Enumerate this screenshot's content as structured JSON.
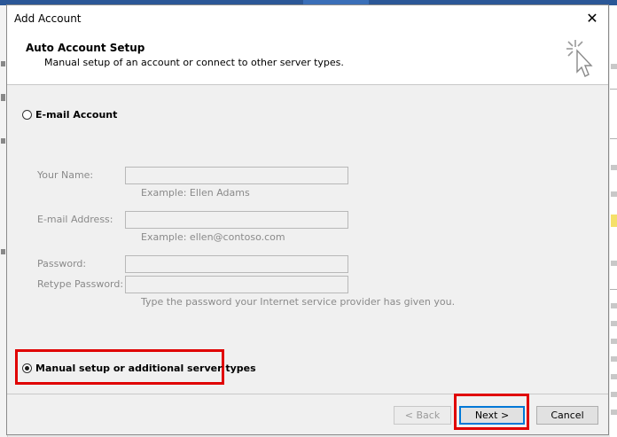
{
  "dialog": {
    "title": "Add Account",
    "close_glyph": "✕",
    "header_title": "Auto Account Setup",
    "header_subtitle": "Manual setup of an account or connect to other server types."
  },
  "options": {
    "email_account_label": "E-mail Account",
    "manual_setup_label": "Manual setup or additional server types",
    "selected": "manual_setup"
  },
  "form": {
    "your_name_label": "Your Name:",
    "your_name_value": "",
    "your_name_hint": "Example: Ellen Adams",
    "email_label": "E-mail Address:",
    "email_value": "",
    "email_hint": "Example: ellen@contoso.com",
    "password_label": "Password:",
    "password_value": "",
    "retype_password_label": "Retype Password:",
    "retype_password_value": "",
    "password_hint": "Type the password your Internet service provider has given you."
  },
  "buttons": {
    "back_label": "< Back",
    "next_label": "Next >",
    "cancel_label": "Cancel"
  },
  "icons": {
    "header": "cursor-click-icon",
    "close": "close-icon"
  },
  "colors": {
    "highlight": "#e00000",
    "default_button_border": "#0078d7",
    "outlook_blue": "#2b5797"
  }
}
